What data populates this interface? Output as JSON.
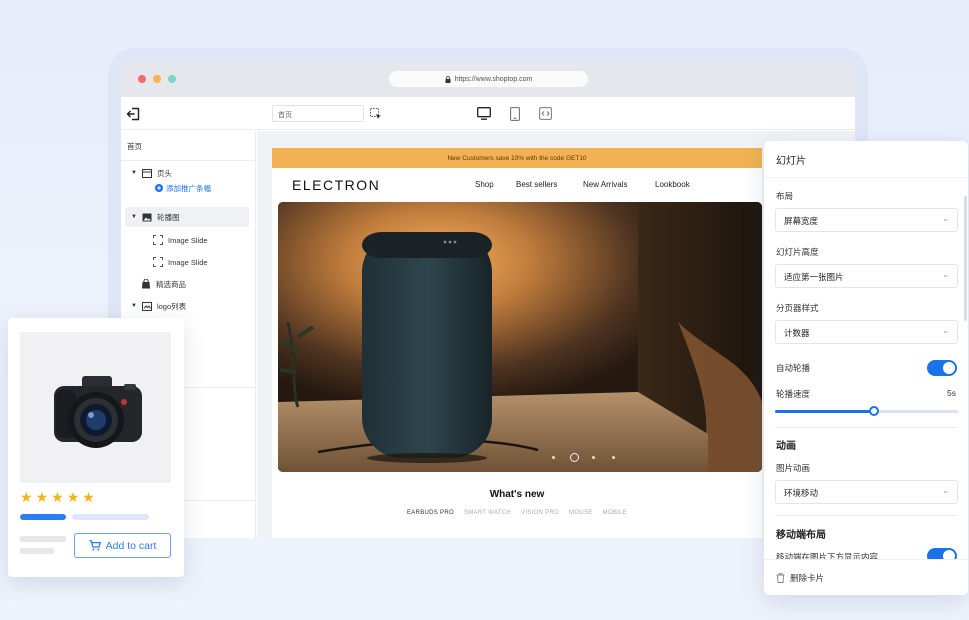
{
  "browser": {
    "url": "https://www.shoptop.com",
    "traffic_lights": [
      "#f26b6b",
      "#f6b54c",
      "#7ad7c1"
    ]
  },
  "editor_toolbar": {
    "page_select_value": "首页",
    "device_icons": [
      "desktop-icon",
      "mobile-icon",
      "fit-width-icon"
    ]
  },
  "tree": {
    "title": "首页",
    "items": [
      {
        "label": "页头",
        "sub": "添加推广条幅"
      },
      {
        "label": "轮播图"
      },
      {
        "label": "Image Slide"
      },
      {
        "label": "Image Slide"
      },
      {
        "label": "精选商品"
      },
      {
        "label": "logo列表"
      }
    ]
  },
  "store": {
    "announcement": "New Customers save 10% with the code GET10",
    "logo": "ELECTRON",
    "nav": [
      "Shop",
      "Best sellers",
      "New Arrivals",
      "Lookbook"
    ],
    "section_title": "What's new",
    "tabs": [
      "EARBUDS PRO",
      "SMART WATCH",
      "VISION PRO",
      "MOUSE",
      "MOBILE"
    ]
  },
  "panel": {
    "title": "幻灯片",
    "layout_label": "布局",
    "layout_value": "屏幕宽度",
    "height_label": "幻灯片高度",
    "height_value": "适应第一张图片",
    "pager_label": "分页器样式",
    "pager_value": "计数器",
    "autoplay_label": "自动轮播",
    "autoplay_on": true,
    "speed_label": "轮播速度",
    "speed_value": "5s",
    "speed_fraction": 0.54,
    "anim_section": "动画",
    "anim_label": "图片动画",
    "anim_value": "环境移动",
    "mobile_section": "移动端布局",
    "mobile_label": "移动端在图片下方显示内容",
    "mobile_on": true,
    "delete_label": "删除卡片"
  },
  "product_card": {
    "rating": 5,
    "button_label": "Add to cart"
  },
  "colors": {
    "accent": "#1a73e8",
    "announcement_bg": "#f2b152",
    "star": "#f6b21b"
  }
}
